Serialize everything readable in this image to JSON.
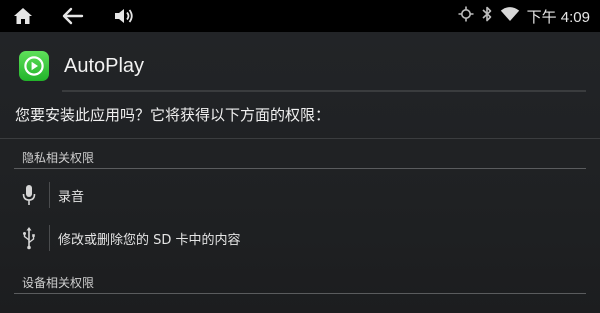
{
  "statusbar": {
    "time": "下午 4:09"
  },
  "app": {
    "name": "AutoPlay",
    "icon": "carplay-app-icon",
    "icon_color": "#3ccb3f"
  },
  "install": {
    "question": "您要安装此应用吗？它将获得以下方面的权限："
  },
  "sections": [
    {
      "title": "隐私相关权限",
      "permissions": [
        {
          "icon": "microphone-icon",
          "label": "录音"
        },
        {
          "icon": "usb-icon",
          "label": "修改或删除您的 SD 卡中的内容"
        }
      ]
    },
    {
      "title": "设备相关权限",
      "permissions": []
    }
  ]
}
